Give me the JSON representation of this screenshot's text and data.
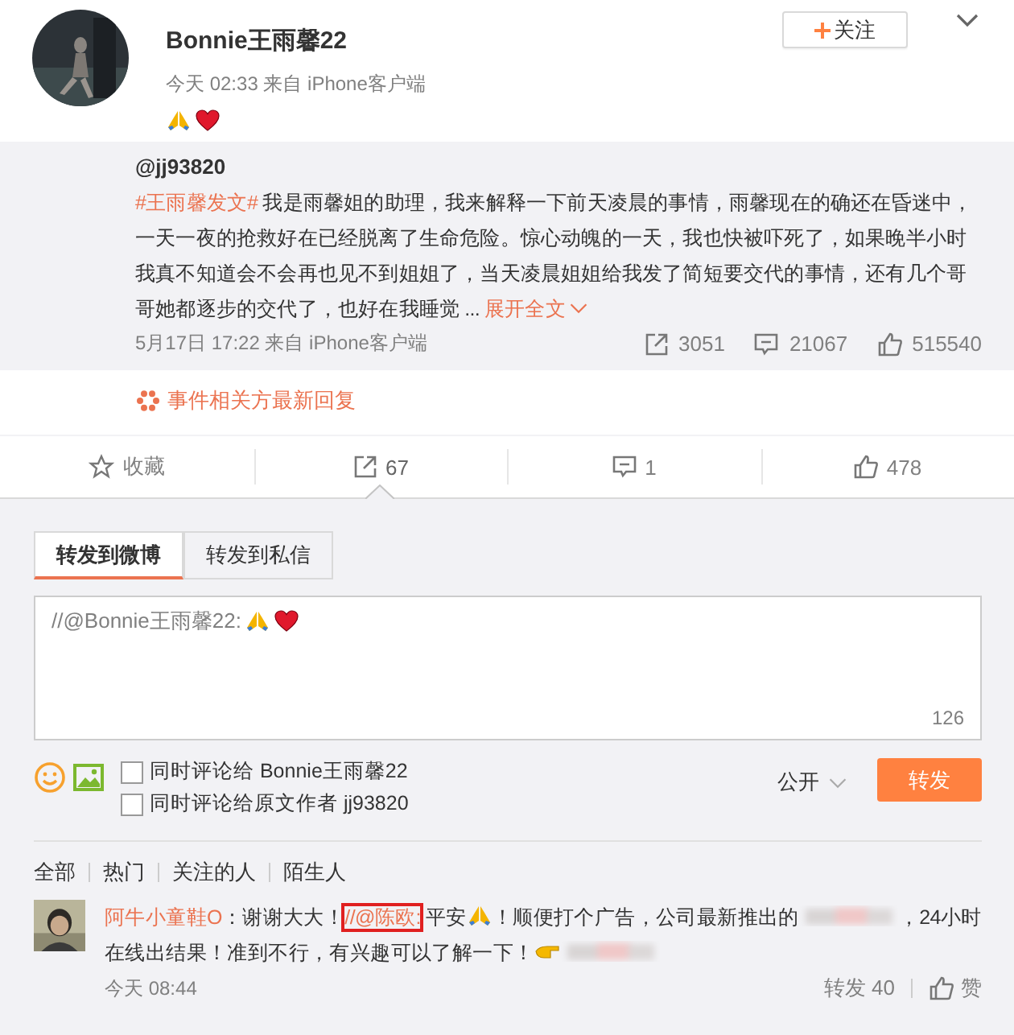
{
  "post": {
    "author": "Bonnie王雨馨22",
    "follow_label": "关注",
    "time": "今天 02:33 来自 iPhone客户端"
  },
  "quoted": {
    "author": "@jj93820",
    "hashtag": "#王雨馨发文#",
    "text": " 我是雨馨姐的助理，我来解释一下前天凌晨的事情，雨馨现在的确还在昏迷中，一天一夜的抢救好在已经脱离了生命危险。惊心动魄的一天，我也快被吓死了，如果晚半小时我真不知道会不会再也见不到姐姐了，当天凌晨姐姐给我发了简短要交代的事情，还有几个哥哥她都逐步的交代了，也好在我睡觉 ...",
    "expand": "展开全文",
    "time": "5月17日 17:22 来自 iPhone客户端",
    "forwards": "3051",
    "comments": "21067",
    "likes": "515540"
  },
  "event_link": "事件相关方最新回复",
  "actions": [
    {
      "kind": "favorite",
      "label": "收藏",
      "selected": false
    },
    {
      "kind": "forward",
      "label": "67",
      "selected": true
    },
    {
      "kind": "comment",
      "label": "1",
      "selected": false
    },
    {
      "kind": "like",
      "label": "478",
      "selected": false
    }
  ],
  "forward_tabs": [
    {
      "label": "转发到微博",
      "selected": true
    },
    {
      "label": "转发到私信",
      "selected": false
    }
  ],
  "compose": {
    "value": "//@Bonnie王雨馨22: ",
    "counter": "126"
  },
  "options": [
    {
      "label": "同时评论给 Bonnie王雨馨22",
      "checked": false
    },
    {
      "label": "同时评论给原文作者 jj93820",
      "checked": false
    }
  ],
  "visibility": "公开",
  "submit": "转发",
  "filters": [
    {
      "label": "全部",
      "selected": false
    },
    {
      "label": "热门",
      "selected": false
    },
    {
      "label": "关注的人",
      "selected": false
    },
    {
      "label": "陌生人",
      "selected": false
    }
  ],
  "comments": [
    {
      "author": "阿牛小童鞋O",
      "segments": [
        {
          "kind": "text",
          "text": "：谢谢大大！"
        },
        {
          "kind": "mention",
          "text": "//@陈欧:",
          "highlighted": true
        },
        {
          "kind": "text",
          "text": "平安"
        },
        {
          "kind": "emoji"
        },
        {
          "kind": "text",
          "text": "！顺便打个广告，公司最新推出的"
        },
        {
          "kind": "blur"
        },
        {
          "kind": "text",
          "text": "，24小时在线出结果！准到不行，有兴趣可以了解一下！"
        },
        {
          "kind": "pointer"
        },
        {
          "kind": "blur"
        }
      ],
      "time": "今天 08:44",
      "forward_label": "转发 40",
      "like_label": "赞"
    }
  ]
}
